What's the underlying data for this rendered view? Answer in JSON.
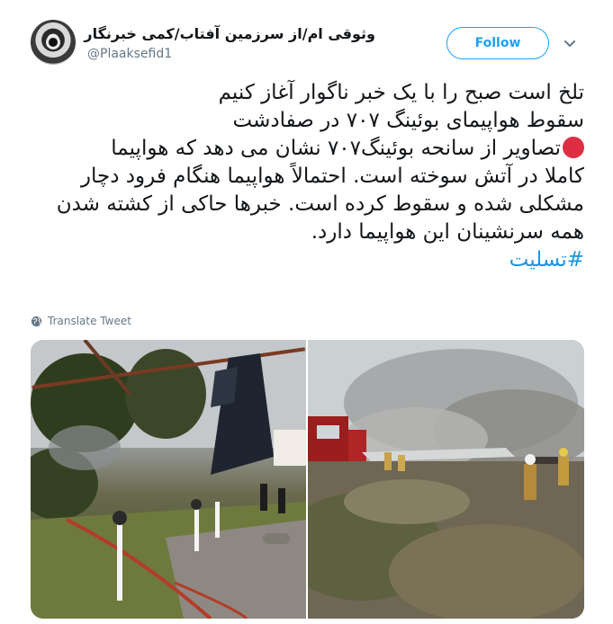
{
  "tweet": {
    "author": {
      "display_name": "وثوقی ام/از سرزمین آفتاب/کمی خبرنگار",
      "handle": "@Plaaksefid1"
    },
    "follow_label": "Follow",
    "text_lines": [
      "تلخ است صبح را با یک خبر ناگوار آغاز کنیم",
      "سقوط هواپیمای بوئینگ ۷۰۷ در صفادشت",
      "تصاویر از سانحه بوئینگ۷۰۷ نشان می دهد که هواپیما",
      "کاملا در آتش سوخته است. احتمالاً هواپیما هنگام فرود دچار",
      "مشکلی شده و سقوط کرده است. خبرها حاکی از کشته شدن",
      "همه سرنشینان این هواپیما دارد."
    ],
    "hashtag": "#تسلیت",
    "translate_label": "Translate Tweet",
    "colors": {
      "accent": "#1da1f2",
      "hashtag": "#1b95e0",
      "red_circle": "#dd2e44",
      "secondary_text": "#657786"
    },
    "icons": {
      "red_circle": "red-circle-emoji",
      "chevron": "chevron-down-icon",
      "globe": "globe-icon"
    }
  }
}
